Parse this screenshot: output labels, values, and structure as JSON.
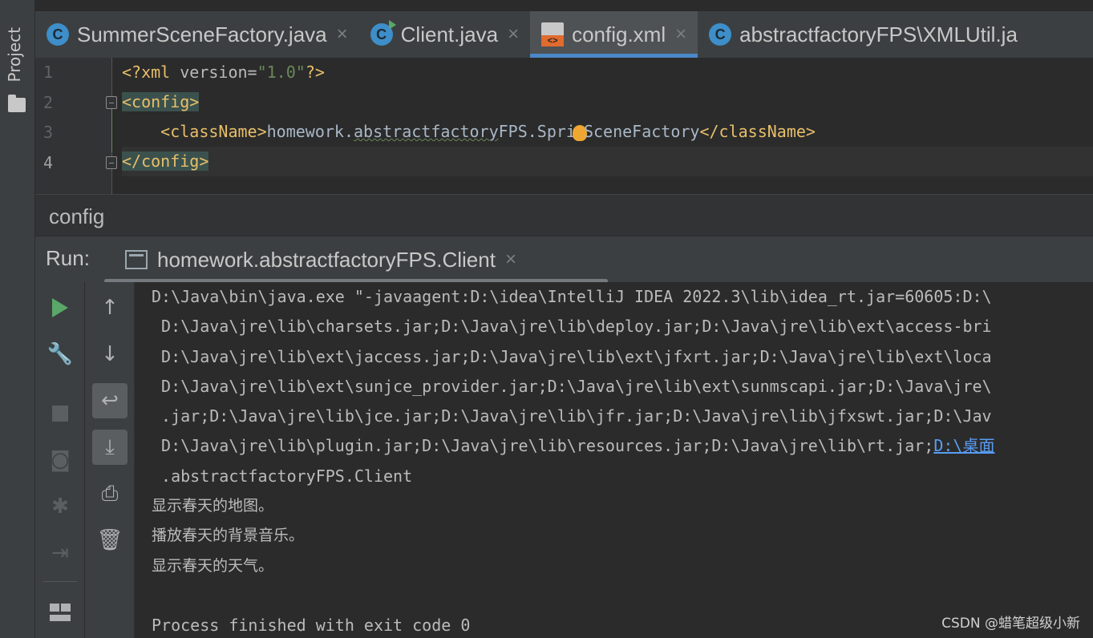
{
  "sidebar": {
    "project_label": "Project"
  },
  "tabs": [
    {
      "label": "SummerSceneFactory.java",
      "icon": "c",
      "close": "×"
    },
    {
      "label": "Client.java",
      "icon": "c",
      "close": "×"
    },
    {
      "label": "config.xml",
      "icon": "xml-icon",
      "close": "×"
    },
    {
      "label": "abstractfactoryFPS\\XMLUtil.ja",
      "icon": "c"
    }
  ],
  "editor": {
    "line_numbers": [
      "1",
      "2",
      "3",
      "4"
    ],
    "line1": {
      "open": "<?xml ",
      "attr": "version",
      "eq": "=",
      "val": "\"1.0\"",
      "close": "?>"
    },
    "line2": {
      "tag": "<config>"
    },
    "line3": {
      "open": "<className>",
      "text_a": "homework.",
      "text_typo": "abstractfactory",
      "text_b": "FPS.Spri",
      "text_c": "SceneFactory",
      "close": "</className>"
    },
    "line4": {
      "tag": "</config>"
    }
  },
  "breadcrumb": {
    "label": "config"
  },
  "run": {
    "label": "Run:",
    "tab_label": "homework.abstractfactoryFPS.Client",
    "tab_close": "×"
  },
  "toolbar": {
    "rerun": "",
    "up": "↑",
    "down": "↓",
    "wrench": "🔧"
  },
  "console": {
    "lines": [
      "D:\\Java\\bin\\java.exe \"-javaagent:D:\\idea\\IntelliJ IDEA 2022.3\\lib\\idea_rt.jar=60605:D:\\",
      " D:\\Java\\jre\\lib\\charsets.jar;D:\\Java\\jre\\lib\\deploy.jar;D:\\Java\\jre\\lib\\ext\\access-bri",
      " D:\\Java\\jre\\lib\\ext\\jaccess.jar;D:\\Java\\jre\\lib\\ext\\jfxrt.jar;D:\\Java\\jre\\lib\\ext\\loca",
      " D:\\Java\\jre\\lib\\ext\\sunjce_provider.jar;D:\\Java\\jre\\lib\\ext\\sunmscapi.jar;D:\\Java\\jre\\",
      " .jar;D:\\Java\\jre\\lib\\jce.jar;D:\\Java\\jre\\lib\\jfr.jar;D:\\Java\\jre\\lib\\jfxswt.jar;D:\\Jav"
    ],
    "line6_text": " D:\\Java\\jre\\lib\\plugin.jar;D:\\Java\\jre\\lib\\resources.jar;D:\\Java\\jre\\lib\\rt.jar;",
    "line6_link": "D:\\桌面",
    "line7": " .abstractfactoryFPS.Client",
    "output": [
      "显示春天的地图。",
      "播放春天的背景音乐。",
      "显示春天的天气。"
    ],
    "blank": "",
    "exit": "Process finished with exit code 0"
  },
  "watermark": "CSDN @蜡笔超级小新"
}
